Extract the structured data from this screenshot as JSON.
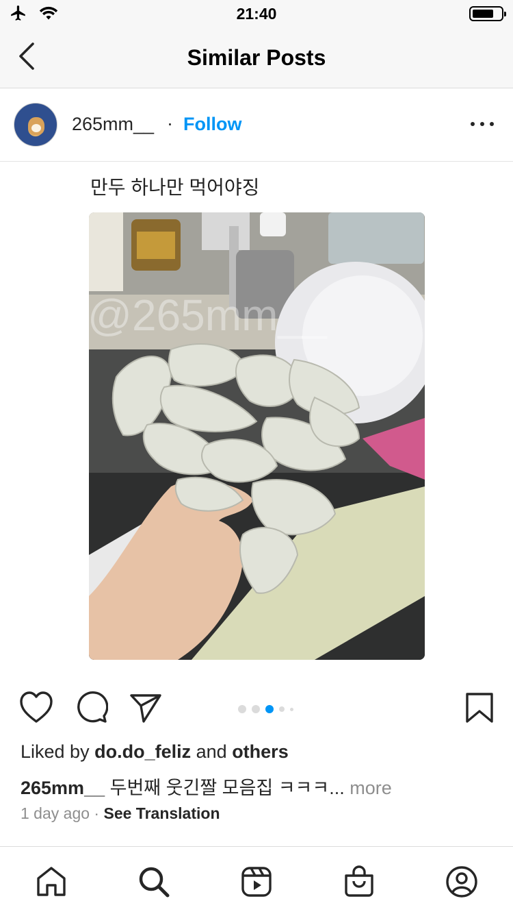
{
  "status_bar": {
    "time": "21:40"
  },
  "header": {
    "title": "Similar Posts"
  },
  "post": {
    "username": "265mm__",
    "follow_label": "Follow",
    "image_caption": "만두 하나만 먹어야징",
    "watermark": "@265mm__",
    "carousel": {
      "count": 5,
      "active_index": 2
    },
    "likes": {
      "prefix": "Liked by",
      "user": "do.do_feliz",
      "and": "and",
      "others": "others"
    },
    "caption": {
      "username": "265mm__",
      "text": "두번째 웃긴짤 모음집 ㅋㅋㅋ...",
      "more": "more"
    },
    "timestamp": "1 day ago",
    "see_translation": "See Translation"
  },
  "icons": {
    "back": "chevron-left-icon",
    "more": "more-horizontal-icon",
    "like": "heart-icon",
    "comment": "comment-icon",
    "share": "send-icon",
    "save": "bookmark-icon"
  },
  "tab_bar": [
    "home-icon",
    "search-icon",
    "reels-icon",
    "shop-icon",
    "profile-icon"
  ],
  "colors": {
    "link": "#0095f6",
    "text": "#262626",
    "secondary": "#8e8e8e"
  }
}
